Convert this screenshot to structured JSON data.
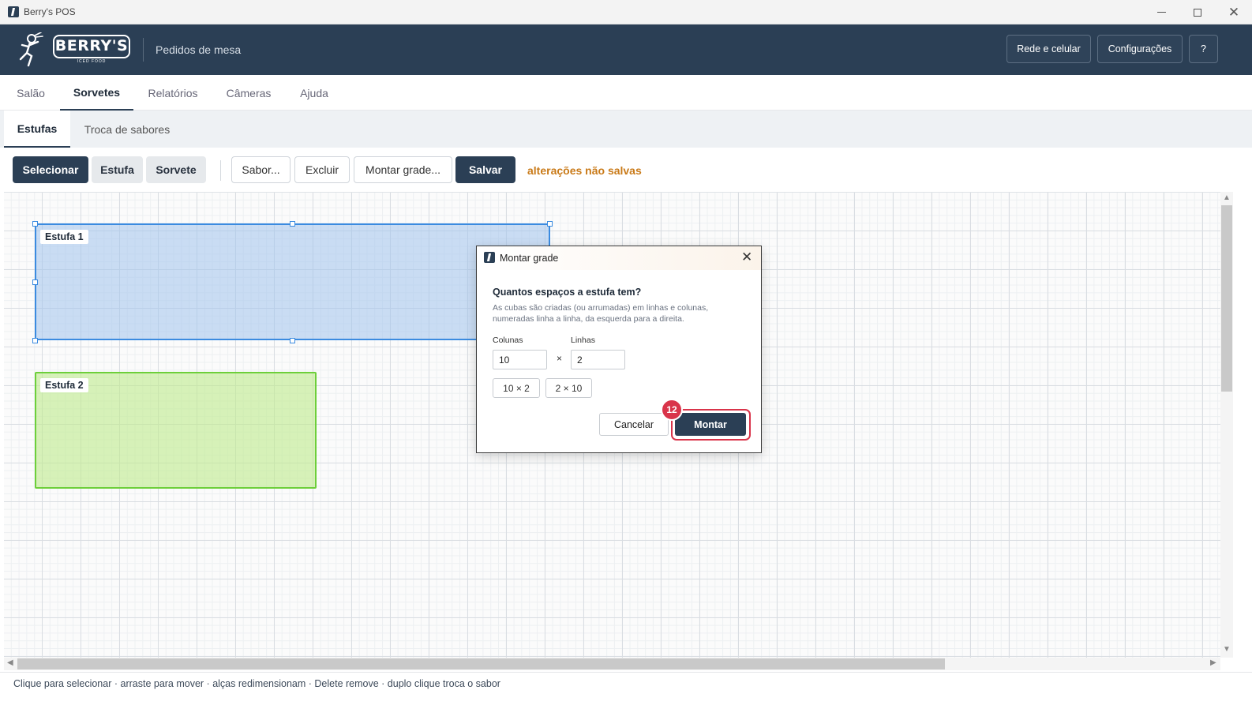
{
  "window": {
    "title": "Berry's POS"
  },
  "header": {
    "logo_text": "BERRY'S",
    "logo_subtext": "ICED FOOD",
    "subtitle": "Pedidos de mesa",
    "buttons": {
      "network": "Rede e celular",
      "settings": "Configurações",
      "help": "?"
    }
  },
  "main_tabs": [
    {
      "label": "Salão",
      "active": false
    },
    {
      "label": "Sorvetes",
      "active": true
    },
    {
      "label": "Relatórios",
      "active": false
    },
    {
      "label": "Câmeras",
      "active": false
    },
    {
      "label": "Ajuda",
      "active": false
    }
  ],
  "sub_tabs": [
    {
      "label": "Estufas",
      "active": true
    },
    {
      "label": "Troca de sabores",
      "active": false
    }
  ],
  "toolbar": {
    "modes": [
      {
        "label": "Selecionar",
        "active": true
      },
      {
        "label": "Estufa",
        "active": false
      },
      {
        "label": "Sorvete",
        "active": false
      }
    ],
    "actions": {
      "flavor": "Sabor...",
      "delete": "Excluir",
      "build_grid": "Montar grade...",
      "save": "Salvar"
    },
    "status": "alterações não salvas"
  },
  "canvas": {
    "estufas": [
      {
        "label": "Estufa 1",
        "selected": true,
        "color": "#3b8be0"
      },
      {
        "label": "Estufa 2",
        "selected": false,
        "color": "#6dcf3a"
      }
    ]
  },
  "status_bar": {
    "hint": "Clique para selecionar · arraste para mover · alças redimensionam · Delete remove · duplo clique troca o sabor"
  },
  "dialog": {
    "title": "Montar grade",
    "question": "Quantos espaços a estufa tem?",
    "description": "As cubas são criadas (ou arrumadas) em linhas e colunas, numeradas linha a linha, da esquerda para a direita.",
    "columns_label": "Colunas",
    "columns_value": "10",
    "rows_label": "Linhas",
    "rows_value": "2",
    "times_symbol": "×",
    "presets": [
      "10 × 2",
      "2 × 10"
    ],
    "cancel": "Cancelar",
    "confirm": "Montar",
    "step_badge": "12"
  },
  "colors": {
    "primary": "#2b3f55",
    "warning": "#c97a18",
    "highlight": "#d9344a"
  }
}
